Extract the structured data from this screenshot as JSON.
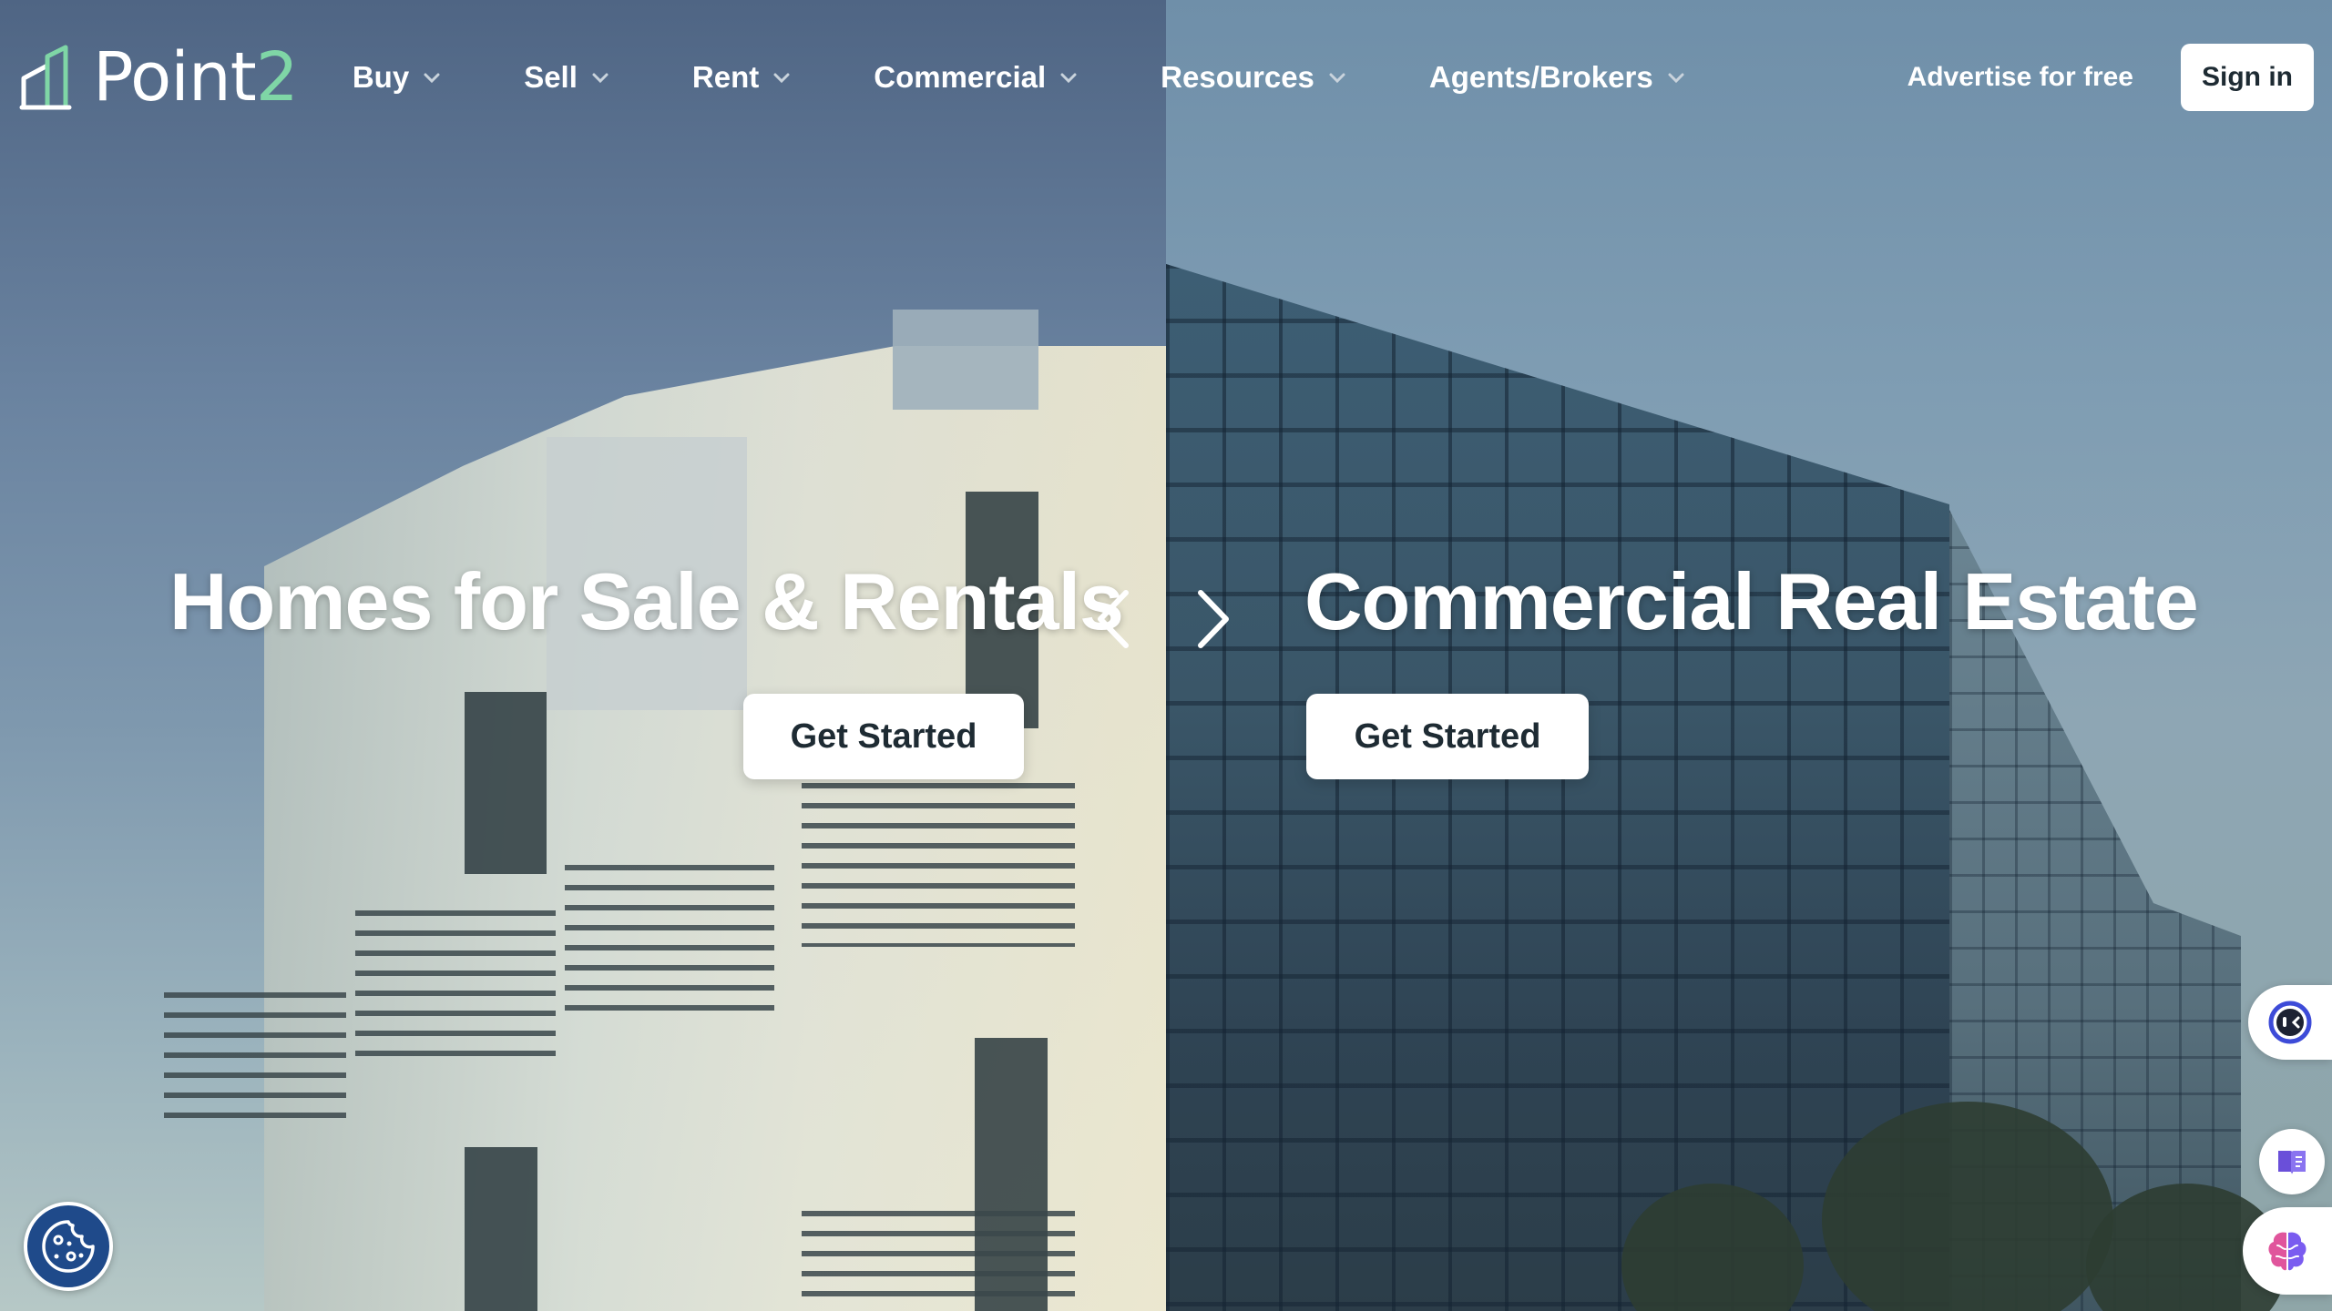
{
  "brand": {
    "name_main": "Point",
    "name_accent": "2",
    "accent_color": "#7fd6a6"
  },
  "nav": {
    "items": [
      {
        "label": "Buy"
      },
      {
        "label": "Sell"
      },
      {
        "label": "Rent"
      },
      {
        "label": "Commercial"
      },
      {
        "label": "Resources"
      },
      {
        "label": "Agents/Brokers"
      }
    ],
    "advertise_label": "Advertise for free",
    "signin_label": "Sign in"
  },
  "hero": {
    "left": {
      "title": "Homes for Sale & Rentals",
      "cta_label": "Get Started"
    },
    "right": {
      "title": "Commercial Real Estate",
      "cta_label": "Get Started"
    },
    "prev_icon": "chevron-left-icon",
    "next_icon": "chevron-right-icon"
  },
  "widgets": {
    "cookie_icon": "cookie-icon",
    "chat_icon": "chat-bot-icon",
    "book_icon": "book-icon",
    "brain_icon": "brain-icon",
    "cookie_color": "#1f4a8a"
  }
}
